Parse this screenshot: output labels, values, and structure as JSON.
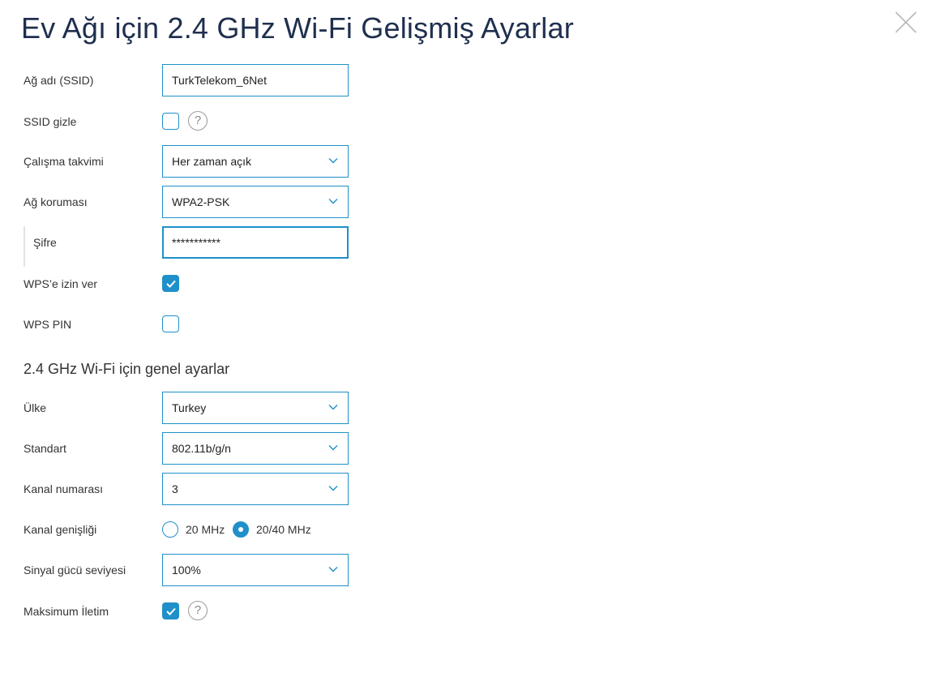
{
  "title": "Ev Ağı için 2.4 GHz Wi-Fi Gelişmiş Ayarlar",
  "accent_color": "#1f90c9",
  "icons": {
    "close": "close-icon",
    "help": "help-icon",
    "dropdown": "chevron-down-icon",
    "check": "checkmark-icon"
  },
  "ssid": {
    "label": "Ağ adı (SSID)",
    "value": "TurkTelekom_6Net"
  },
  "hide_ssid": {
    "label": "SSID gizle",
    "checked": false,
    "help": "?"
  },
  "schedule": {
    "label": "Çalışma takvimi",
    "value": "Her zaman açık"
  },
  "protection": {
    "label": "Ağ koruması",
    "value": "WPA2-PSK"
  },
  "password": {
    "label": "Şifre",
    "value": "***********"
  },
  "wps_allow": {
    "label": "WPS’e izin ver",
    "checked": true
  },
  "wps_pin": {
    "label": "WPS PIN",
    "checked": false
  },
  "general_section_title": "2.4 GHz Wi-Fi için genel ayarlar",
  "country": {
    "label": "Ülke",
    "value": "Turkey"
  },
  "standard": {
    "label": "Standart",
    "value": "802.11b/g/n"
  },
  "channel": {
    "label": "Kanal numarası",
    "value": "3"
  },
  "channel_width": {
    "label": "Kanal genişliği",
    "options": [
      "20 MHz",
      "20/40 MHz"
    ],
    "selected": "20/40 MHz"
  },
  "tx_power": {
    "label": "Sinyal gücü seviyesi",
    "value": "100%"
  },
  "max_tx": {
    "label": "Maksimum İletim",
    "checked": true,
    "help": "?"
  }
}
